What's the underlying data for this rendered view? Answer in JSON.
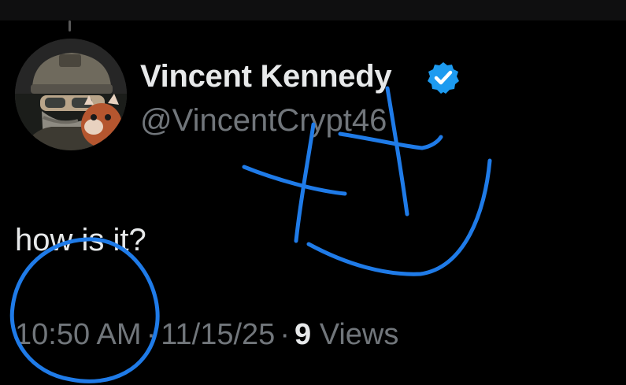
{
  "tweet": {
    "author": {
      "display_name": "Vincent Kennedy",
      "handle": "@VincentCrypt46",
      "verified": true,
      "verified_badge_color": "#1d9bf0"
    },
    "text": "how is it?",
    "time": "10:50 AM",
    "separator": "·",
    "date": "11/15/25",
    "views_count": "9",
    "views_label": "Views"
  },
  "annotations": {
    "color": "#1f7be8",
    "items": [
      "circle-around-time",
      "hand-drawn-scribble"
    ]
  },
  "colors": {
    "background": "#000000",
    "primary_text": "#e7e9ea",
    "secondary_text": "#71767b"
  }
}
